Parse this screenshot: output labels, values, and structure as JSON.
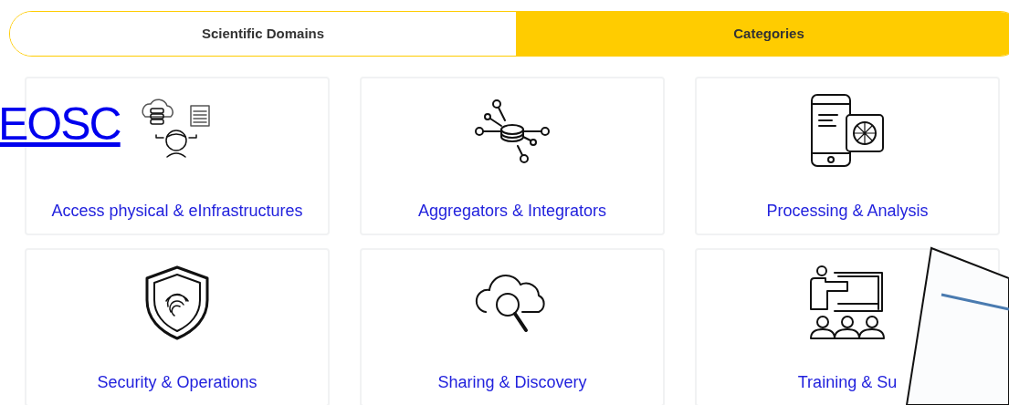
{
  "tabs": [
    {
      "label": "Scientific Domains",
      "selected": false
    },
    {
      "label": "Categories",
      "selected": true
    }
  ],
  "overlay_link": "EOSC",
  "categories": [
    {
      "label": "Access physical & eInfrastructures"
    },
    {
      "label": "Aggregators & Integrators"
    },
    {
      "label": "Processing & Analysis"
    },
    {
      "label": "Security & Operations"
    },
    {
      "label": "Sharing & Discovery"
    },
    {
      "label": "Training & Su"
    }
  ]
}
